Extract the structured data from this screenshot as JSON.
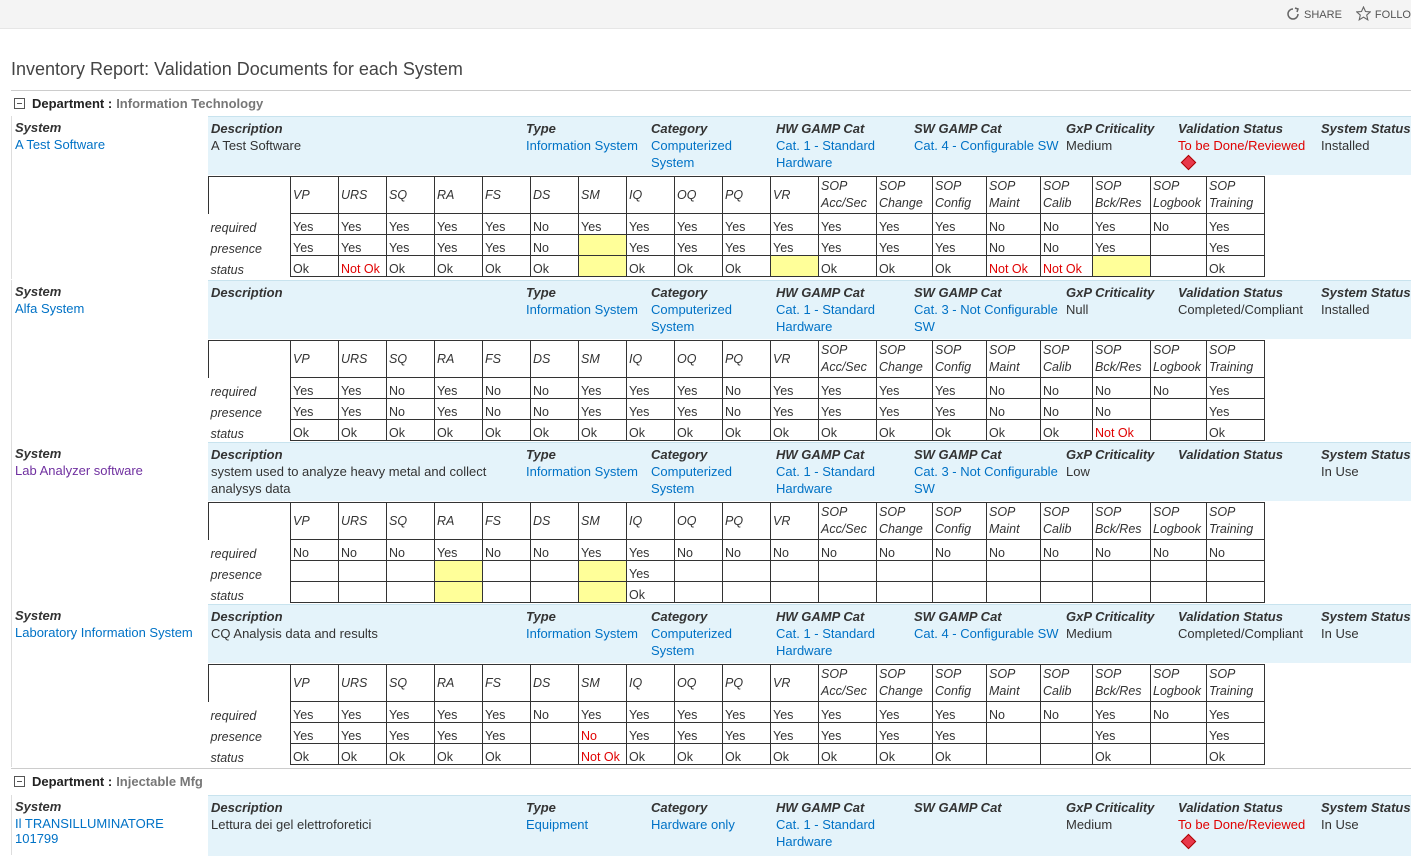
{
  "topbar": {
    "share_label": "SHARE",
    "follow_label": "FOLLO"
  },
  "page_title": "Inventory Report: Validation Documents for each System",
  "headers": {
    "system": "System",
    "description": "Description",
    "type": "Type",
    "category": "Category",
    "hw_gamp": "HW GAMP Cat",
    "sw_gamp": "SW GAMP Cat",
    "gxp": "GxP Criticality",
    "validation": "Validation Status",
    "system_status": "System Status"
  },
  "doc_columns": [
    "VP",
    "URS",
    "SQ",
    "RA",
    "FS",
    "DS",
    "SM",
    "IQ",
    "OQ",
    "PQ",
    "VR",
    "SOP Acc/Sec",
    "SOP Change",
    "SOP Config",
    "SOP Maint",
    "SOP Calib",
    "SOP Bck/Res",
    "SOP Logbook",
    "SOP Training"
  ],
  "row_labels": {
    "required": "required",
    "presence": "presence",
    "status": "status"
  },
  "departments": [
    {
      "key": "Department :",
      "value": "Information Technology"
    },
    {
      "key": "Department :",
      "value": "Injectable Mfg"
    }
  ],
  "systems": [
    {
      "name": "A Test Software",
      "description": "A Test Software",
      "type": "Information System",
      "category": "Computerized System",
      "hw_gamp": "Cat. 1 - Standard Hardware",
      "sw_gamp": "Cat. 4 - Configurable SW",
      "gxp": "Medium",
      "validation": "To be Done/Reviewed",
      "system_status": "Installed",
      "required": [
        "Yes",
        "Yes",
        "Yes",
        "Yes",
        "Yes",
        "No",
        "Yes",
        "Yes",
        "Yes",
        "Yes",
        "Yes",
        "Yes",
        "Yes",
        "Yes",
        "No",
        "No",
        "Yes",
        "No",
        "Yes"
      ],
      "presence": [
        "Yes",
        "Yes",
        "Yes",
        "Yes",
        "Yes",
        "No",
        "",
        "Yes",
        "Yes",
        "Yes",
        "Yes",
        "Yes",
        "Yes",
        "Yes",
        "No",
        "No",
        "Yes",
        "",
        "Yes"
      ],
      "status": [
        "Ok",
        "Not Ok",
        "Ok",
        "Ok",
        "Ok",
        "Ok",
        "",
        "Ok",
        "Ok",
        "Ok",
        "",
        "Ok",
        "Ok",
        "Ok",
        "Not Ok",
        "Not Ok",
        "",
        "",
        "Ok"
      ],
      "highlight": [
        6,
        10,
        16
      ],
      "presence_highlight": [
        6
      ]
    },
    {
      "name": "Alfa System",
      "description": "",
      "type": "Information System",
      "category": "Computerized System",
      "hw_gamp": "Cat. 1 - Standard Hardware",
      "sw_gamp": "Cat. 3 - Not Configurable SW",
      "gxp": "Null",
      "validation": "Completed/Compliant",
      "system_status": "Installed",
      "required": [
        "Yes",
        "Yes",
        "No",
        "Yes",
        "No",
        "No",
        "Yes",
        "Yes",
        "Yes",
        "No",
        "Yes",
        "Yes",
        "Yes",
        "Yes",
        "No",
        "No",
        "No",
        "No",
        "Yes"
      ],
      "presence": [
        "Yes",
        "Yes",
        "No",
        "Yes",
        "No",
        "No",
        "Yes",
        "Yes",
        "Yes",
        "No",
        "Yes",
        "Yes",
        "Yes",
        "Yes",
        "No",
        "No",
        "No",
        "",
        "Yes"
      ],
      "status": [
        "Ok",
        "Ok",
        "Ok",
        "Ok",
        "Ok",
        "Ok",
        "Ok",
        "Ok",
        "Ok",
        "Ok",
        "Ok",
        "Ok",
        "Ok",
        "Ok",
        "Ok",
        "Ok",
        "Not Ok",
        "",
        "Ok"
      ]
    },
    {
      "name": "Lab Analyzer software",
      "description": "system used to analyze heavy metal and collect analysys data",
      "type": "Information System",
      "category": "Computerized System",
      "hw_gamp": "Cat. 1 - Standard Hardware",
      "sw_gamp": "Cat. 3 - Not Configurable SW",
      "gxp": "Low",
      "validation": "",
      "system_status": "In Use",
      "required": [
        "No",
        "No",
        "No",
        "Yes",
        "No",
        "No",
        "Yes",
        "Yes",
        "No",
        "No",
        "No",
        "No",
        "No",
        "No",
        "No",
        "No",
        "No",
        "No",
        "No"
      ],
      "presence": [
        "",
        "",
        "",
        "",
        "",
        "",
        "",
        "Yes",
        "",
        "",
        "",
        "",
        "",
        "",
        "",
        "",
        "",
        "",
        ""
      ],
      "status": [
        "",
        "",
        "",
        "",
        "",
        "",
        "",
        "Ok",
        "",
        "",
        "",
        "",
        "",
        "",
        "",
        "",
        "",
        "",
        ""
      ],
      "highlight": [
        3,
        6
      ],
      "presence_highlight": [
        3,
        6
      ]
    },
    {
      "name": "Laboratory Information System",
      "description": "CQ Analysis data and results",
      "type": "Information System",
      "category": "Computerized System",
      "hw_gamp": "Cat. 1 - Standard Hardware",
      "sw_gamp": "Cat. 4 - Configurable SW",
      "gxp": "Medium",
      "validation": "Completed/Compliant",
      "system_status": "In Use",
      "required": [
        "Yes",
        "Yes",
        "Yes",
        "Yes",
        "Yes",
        "No",
        "Yes",
        "Yes",
        "Yes",
        "Yes",
        "Yes",
        "Yes",
        "Yes",
        "Yes",
        "No",
        "No",
        "Yes",
        "No",
        "Yes"
      ],
      "presence": [
        "Yes",
        "Yes",
        "Yes",
        "Yes",
        "Yes",
        "",
        "No",
        "Yes",
        "Yes",
        "Yes",
        "Yes",
        "Yes",
        "Yes",
        "Yes",
        "",
        "",
        "Yes",
        "",
        "Yes"
      ],
      "status": [
        "Ok",
        "Ok",
        "Ok",
        "Ok",
        "Ok",
        "",
        "Not Ok",
        "Ok",
        "Ok",
        "Ok",
        "Ok",
        "Ok",
        "Ok",
        "Ok",
        "",
        "",
        "Ok",
        "",
        "Ok"
      ]
    },
    {
      "name": "Il TRANSILLUMINATORE 101799",
      "description": "Lettura dei gel elettroforetici",
      "type": "Equipment",
      "category": "Hardware only",
      "hw_gamp": "Cat. 1 - Standard Hardware",
      "sw_gamp": "",
      "gxp": "Medium",
      "validation": "To be Done/Reviewed",
      "system_status": "In Use"
    }
  ],
  "colors": {
    "link": "#0072c6",
    "alert": "#e00000",
    "highlight": "#ffff99",
    "info_bg": "#e4f3fa"
  }
}
